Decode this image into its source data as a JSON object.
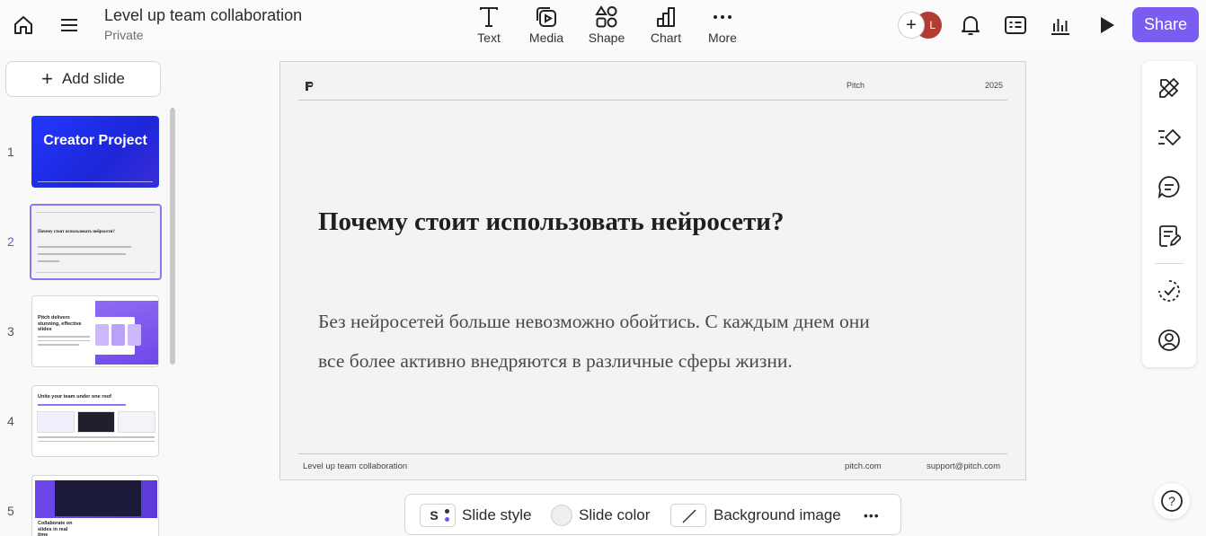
{
  "header": {
    "title": "Level up team collaboration",
    "visibility": "Private",
    "tools": [
      {
        "label": "Text",
        "icon": "text-icon"
      },
      {
        "label": "Media",
        "icon": "media-icon"
      },
      {
        "label": "Shape",
        "icon": "shape-icon"
      },
      {
        "label": "Chart",
        "icon": "chart-icon"
      },
      {
        "label": "More",
        "icon": "more-icon"
      }
    ],
    "add_collaborator": "+",
    "avatar_initial": "L",
    "share_label": "Share",
    "accent_color": "#7a5cf0"
  },
  "sidebar": {
    "add_slide_label": "Add slide",
    "slides": [
      {
        "number": "1",
        "title": "Creator Project"
      },
      {
        "number": "2",
        "title": "Почему стоит использовать нейросети?"
      },
      {
        "number": "3",
        "title": "Pitch delivers stunning, effective slides"
      },
      {
        "number": "4",
        "title": "Unite your team under one roof"
      },
      {
        "number": "5",
        "title": "Collaborate on slides in real time"
      }
    ],
    "active_slide": 2
  },
  "slide": {
    "header_brand": "Pitch",
    "header_year": "2025",
    "title": "Почему стоит использовать нейросети?",
    "body": "Без нейросетей больше невозможно обойтись. С каждым днем они все более активно внедряются в различные сферы жизни.",
    "footer_left": "Level up team collaboration",
    "footer_center": "pitch.com",
    "footer_right": "support@pitch.com"
  },
  "bottom_toolbar": {
    "style_chip": "S",
    "slide_style": "Slide style",
    "slide_color": "Slide color",
    "background_image": "Background image",
    "more": "•••"
  },
  "right_rail": {
    "icons": [
      "design-tools-icon",
      "animate-icon",
      "comment-icon",
      "notes-icon",
      "checklist-icon",
      "account-icon"
    ]
  },
  "help_label": "?"
}
